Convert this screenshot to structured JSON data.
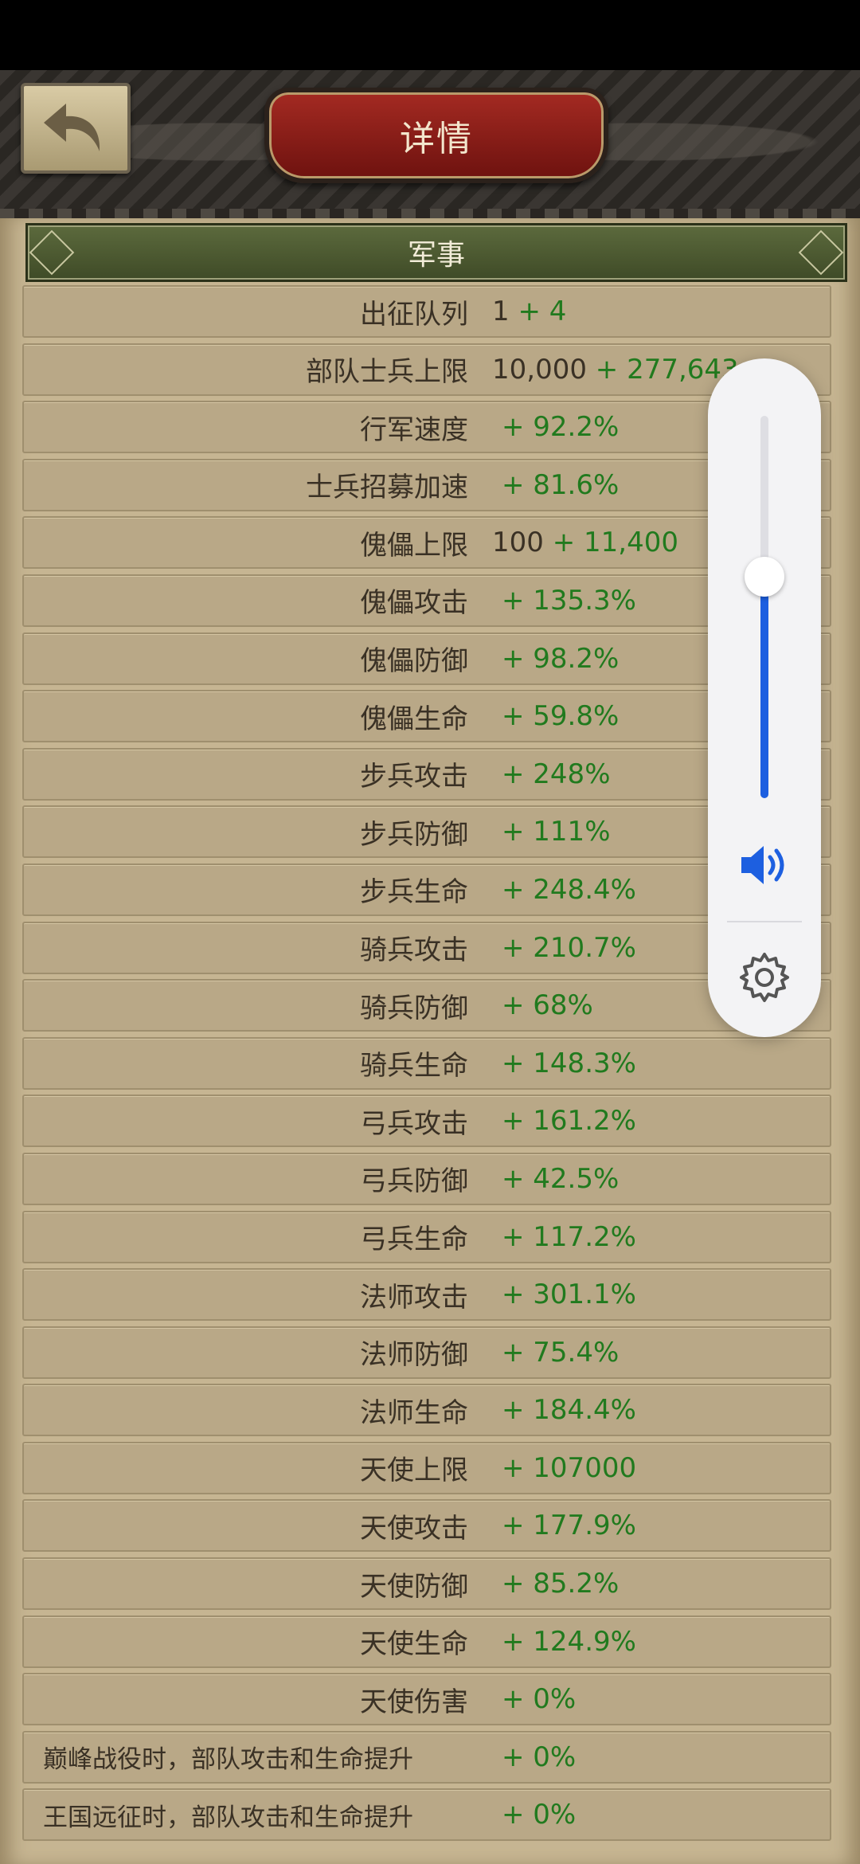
{
  "header": {
    "title": "详情"
  },
  "section": {
    "title": "军事"
  },
  "stats": [
    {
      "label": "出征队列",
      "base": "1",
      "bonus": " + 4"
    },
    {
      "label": "部队士兵上限",
      "base": "10,000",
      "bonus": " + 277,643"
    },
    {
      "label": "行军速度",
      "base": "",
      "bonus": "+ 92.2%"
    },
    {
      "label": "士兵招募加速",
      "base": "",
      "bonus": "+ 81.6%"
    },
    {
      "label": "傀儡上限",
      "base": "100",
      "bonus": " + 11,400"
    },
    {
      "label": "傀儡攻击",
      "base": "",
      "bonus": "+ 135.3%"
    },
    {
      "label": "傀儡防御",
      "base": "",
      "bonus": "+ 98.2%"
    },
    {
      "label": "傀儡生命",
      "base": "",
      "bonus": "+ 59.8%"
    },
    {
      "label": "步兵攻击",
      "base": "",
      "bonus": "+ 248%"
    },
    {
      "label": "步兵防御",
      "base": "",
      "bonus": "+ 111%"
    },
    {
      "label": "步兵生命",
      "base": "",
      "bonus": "+ 248.4%"
    },
    {
      "label": "骑兵攻击",
      "base": "",
      "bonus": "+ 210.7%"
    },
    {
      "label": "骑兵防御",
      "base": "",
      "bonus": "+ 68%"
    },
    {
      "label": "骑兵生命",
      "base": "",
      "bonus": "+ 148.3%"
    },
    {
      "label": "弓兵攻击",
      "base": "",
      "bonus": "+ 161.2%"
    },
    {
      "label": "弓兵防御",
      "base": "",
      "bonus": "+ 42.5%"
    },
    {
      "label": "弓兵生命",
      "base": "",
      "bonus": "+ 117.2%"
    },
    {
      "label": "法师攻击",
      "base": "",
      "bonus": "+ 301.1%"
    },
    {
      "label": "法师防御",
      "base": "",
      "bonus": "+ 75.4%"
    },
    {
      "label": "法师生命",
      "base": "",
      "bonus": "+ 184.4%"
    },
    {
      "label": "天使上限",
      "base": "",
      "bonus": "+ 107000"
    },
    {
      "label": "天使攻击",
      "base": "",
      "bonus": "+ 177.9%"
    },
    {
      "label": "天使防御",
      "base": "",
      "bonus": "+ 85.2%"
    },
    {
      "label": "天使生命",
      "base": "",
      "bonus": "+ 124.9%"
    },
    {
      "label": "天使伤害",
      "base": "",
      "bonus": "+ 0%"
    },
    {
      "label": "巅峰战役时，部队攻击和生命提升",
      "base": "",
      "bonus": "+ 0%",
      "align": "left"
    },
    {
      "label": "王国远征时，部队攻击和生命提升",
      "base": "",
      "bonus": "+ 0%",
      "align": "left"
    }
  ],
  "volume_overlay": {
    "level": 0.58,
    "icons": [
      "speaker-icon",
      "gear-icon"
    ]
  },
  "colors": {
    "bonus": "#217a1e",
    "accent": "#1d5fe0"
  }
}
